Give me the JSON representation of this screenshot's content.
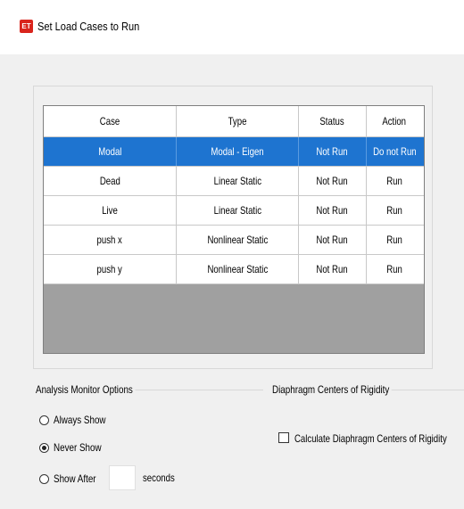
{
  "window": {
    "icon_text": "ET",
    "title": "Set Load Cases to Run"
  },
  "table": {
    "headers": [
      "Case",
      "Type",
      "Status",
      "Action"
    ],
    "rows": [
      {
        "case": "Modal",
        "type": "Modal - Eigen",
        "status": "Not Run",
        "action": "Do not Run",
        "selected": true
      },
      {
        "case": "Dead",
        "type": "Linear Static",
        "status": "Not Run",
        "action": "Run",
        "selected": false
      },
      {
        "case": "Live",
        "type": "Linear Static",
        "status": "Not Run",
        "action": "Run",
        "selected": false
      },
      {
        "case": "push x",
        "type": "Nonlinear Static",
        "status": "Not Run",
        "action": "Run",
        "selected": false
      },
      {
        "case": "push y",
        "type": "Nonlinear Static",
        "status": "Not Run",
        "action": "Run",
        "selected": false
      }
    ]
  },
  "analysis_monitor": {
    "title": "Analysis Monitor Options",
    "always_show": "Always Show",
    "never_show": "Never Show",
    "show_after": "Show After",
    "seconds_value": "",
    "seconds_label": "seconds",
    "selected": "never_show"
  },
  "diaphragm": {
    "title": "Diaphragm Centers of Rigidity",
    "checkbox_label": "Calculate Diaphragm Centers of Rigidity",
    "checked": false
  },
  "colors": {
    "selection": "#1e74d0",
    "grid_empty": "#a0a0a0",
    "icon": "#d9241c"
  }
}
